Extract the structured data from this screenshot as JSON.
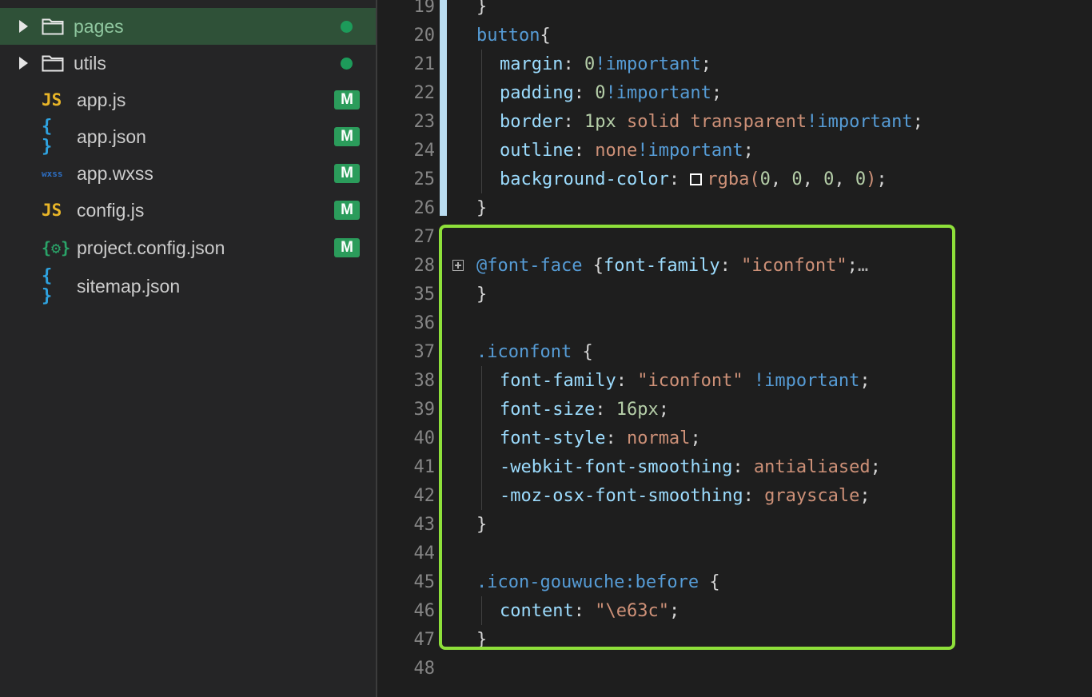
{
  "sidebar": {
    "items": [
      {
        "type": "folder",
        "label": "pages",
        "status": "dot",
        "selected": true
      },
      {
        "type": "folder",
        "label": "utils",
        "status": "dot",
        "selected": false
      },
      {
        "type": "file",
        "icon": "js-icon",
        "icon_text": "JS",
        "label": "app.js",
        "status": "M"
      },
      {
        "type": "file",
        "icon": "json-icon",
        "icon_text": "{ }",
        "label": "app.json",
        "status": "M"
      },
      {
        "type": "file",
        "icon": "wxss-icon",
        "icon_text": "wxss",
        "label": "app.wxss",
        "status": "M"
      },
      {
        "type": "file",
        "icon": "js-icon",
        "icon_text": "JS",
        "label": "config.js",
        "status": "M"
      },
      {
        "type": "file",
        "icon": "config-icon",
        "icon_text": "{⚙}",
        "label": "project.config.json",
        "status": "M"
      },
      {
        "type": "file",
        "icon": "json-icon",
        "icon_text": "{ }",
        "label": "sitemap.json",
        "status": ""
      }
    ]
  },
  "editor": {
    "lines": [
      {
        "num": "19",
        "text": "}"
      },
      {
        "num": "20",
        "text": "button{"
      },
      {
        "num": "21",
        "text": "margin: 0!important;"
      },
      {
        "num": "22",
        "text": "padding: 0!important;"
      },
      {
        "num": "23",
        "text": "border: 1px solid transparent!important;"
      },
      {
        "num": "24",
        "text": "outline: none!important;"
      },
      {
        "num": "25",
        "text": "background-color: rgba(0, 0, 0, 0);"
      },
      {
        "num": "26",
        "text": "}"
      },
      {
        "num": "27",
        "text": ""
      },
      {
        "num": "28",
        "text": "@font-face {font-family: \"iconfont\";…"
      },
      {
        "num": "35",
        "text": "}"
      },
      {
        "num": "36",
        "text": ""
      },
      {
        "num": "37",
        "text": ".iconfont {"
      },
      {
        "num": "38",
        "text": "font-family: \"iconfont\" !important;"
      },
      {
        "num": "39",
        "text": "font-size: 16px;"
      },
      {
        "num": "40",
        "text": "font-style: normal;"
      },
      {
        "num": "41",
        "text": "-webkit-font-smoothing: antialiased;"
      },
      {
        "num": "42",
        "text": "-moz-osx-font-smoothing: grayscale;"
      },
      {
        "num": "43",
        "text": "}"
      },
      {
        "num": "44",
        "text": ""
      },
      {
        "num": "45",
        "text": ".icon-gouwuche:before {"
      },
      {
        "num": "46",
        "text": "content: \"\\e63c\";"
      },
      {
        "num": "47",
        "text": "}"
      },
      {
        "num": "48",
        "text": ""
      }
    ]
  },
  "colors": {
    "highlight_border": "#8ee03a",
    "badge_modified": "#2b9c5b",
    "selected_row": "#2f5138"
  }
}
